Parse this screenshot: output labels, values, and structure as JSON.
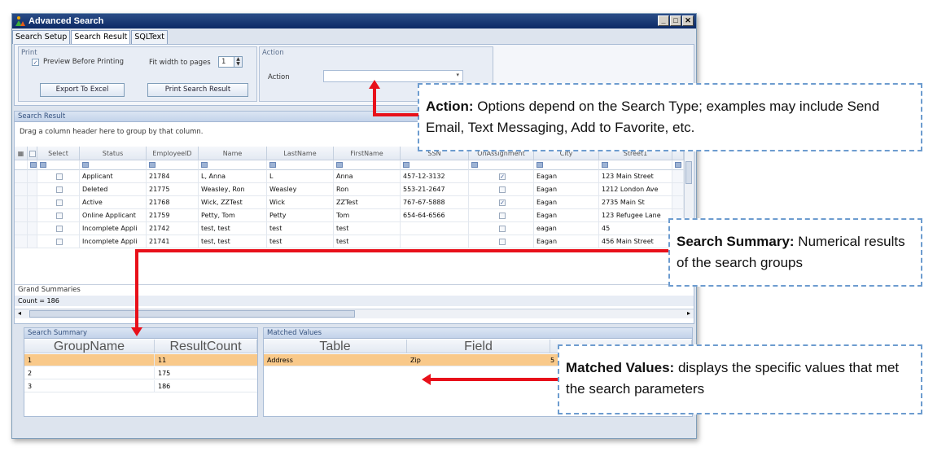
{
  "window": {
    "title": "Advanced Search"
  },
  "tabs": [
    "Search Setup",
    "Search Result",
    "SQLText"
  ],
  "print_group": {
    "title": "Print",
    "preview_label": "Preview Before Printing",
    "fit_width_label": "Fit width to pages",
    "fit_width_value": "1",
    "export_button": "Export To Excel",
    "print_button": "Print Search Result"
  },
  "action_group": {
    "title": "Action",
    "label": "Action",
    "value": ""
  },
  "search_result": {
    "title": "Search Result",
    "group_hint": "Drag a column header here to group by that column.",
    "columns": [
      "Select",
      "Status",
      "EmployeeID",
      "Name",
      "LastName",
      "FirstName",
      "SSN",
      "OnAssignment",
      "City",
      "Street1"
    ],
    "rows": [
      {
        "select": false,
        "status": "Applicant",
        "id": "21784",
        "name": "L, Anna",
        "last": "L",
        "first": "Anna",
        "ssn": "457-12-3132",
        "onassign": true,
        "city": "Eagan",
        "street": "123 Main Street"
      },
      {
        "select": false,
        "status": "Deleted",
        "id": "21775",
        "name": "Weasley, Ron",
        "last": "Weasley",
        "first": "Ron",
        "ssn": "553-21-2647",
        "onassign": false,
        "city": "Eagan",
        "street": "1212 London Ave"
      },
      {
        "select": false,
        "status": "Active",
        "id": "21768",
        "name": "Wick, ZZTest",
        "last": "Wick",
        "first": "ZZTest",
        "ssn": "767-67-5888",
        "onassign": true,
        "city": "Eagan",
        "street": "2735 Main St"
      },
      {
        "select": false,
        "status": "Online Applicant",
        "id": "21759",
        "name": "Petty, Tom",
        "last": "Petty",
        "first": "Tom",
        "ssn": "654-64-6566",
        "onassign": false,
        "city": "Eagan",
        "street": "123 Refugee Lane"
      },
      {
        "select": false,
        "status": "Incomplete Appli",
        "id": "21742",
        "name": "test, test",
        "last": "test",
        "first": "test",
        "ssn": "",
        "onassign": false,
        "city": "eagan",
        "street": "45"
      },
      {
        "select": false,
        "status": "Incomplete Appli",
        "id": "21741",
        "name": "test, test",
        "last": "test",
        "first": "test",
        "ssn": "",
        "onassign": false,
        "city": "Eagan",
        "street": "456 Main Street"
      }
    ],
    "grand_summaries_label": "Grand Summaries",
    "count_label": "Count = 186"
  },
  "search_summary": {
    "title": "Search Summary",
    "columns": [
      "GroupName",
      "ResultCount"
    ],
    "rows": [
      {
        "group": "1",
        "count": "11"
      },
      {
        "group": "2",
        "count": "175"
      },
      {
        "group": "3",
        "count": "186"
      }
    ]
  },
  "matched_values": {
    "title": "Matched Values",
    "columns": [
      "Table",
      "Field"
    ],
    "rows": [
      {
        "table": "Address",
        "field": "Zip",
        "value": "5"
      }
    ]
  },
  "callouts": {
    "action": {
      "bold": "Action:",
      "text": "  Options depend on the Search Type; examples may include Send Email, Text Messaging, Add to Favorite, etc."
    },
    "summary": {
      "bold": "Search Summary:",
      "text": " Numerical results of the search groups"
    },
    "matched": {
      "bold": "Matched Values:",
      "text": " displays the specific values that met the search parameters"
    }
  },
  "colors": {
    "highlight_row": "#f9c98a",
    "arrow": "#e8101a",
    "callout_border": "#6d9ccf"
  }
}
